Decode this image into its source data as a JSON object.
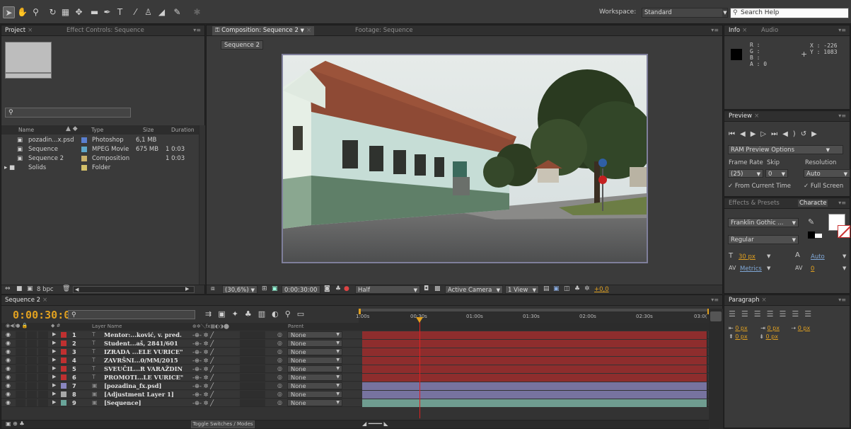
{
  "toolbar": {
    "workspace_label": "Workspace:",
    "workspace_value": "Standard",
    "search_placeholder": "Search Help",
    "tools": [
      "selection-tool-icon",
      "hand-tool-icon",
      "zoom-tool-icon",
      "rotate-tool-icon",
      "camera-tool-icon",
      "pan-behind-tool-icon",
      "mask-tool-icon",
      "pen-tool-icon",
      "type-tool-icon",
      "brush-tool-icon",
      "clone-stamp-icon",
      "eraser-icon",
      "roto-brush-icon",
      "puppet-pin-icon"
    ]
  },
  "project": {
    "tab_project": "Project",
    "tab_effects": "Effect Controls: Sequence",
    "columns": {
      "name": "Name",
      "type": "Type",
      "size": "Size",
      "duration": "Duration"
    },
    "items": [
      {
        "name": "pozadin...x.psd",
        "type": "Photoshop",
        "size": "6,1 MB",
        "duration": "",
        "color": "#5a7fd0",
        "icon": "photoshop-file-icon"
      },
      {
        "name": "Sequence",
        "type": "MPEG Movie",
        "size": "675 MB",
        "duration": "1 0:03",
        "color": "#5fa6c9",
        "icon": "movie-file-icon"
      },
      {
        "name": "Sequence 2",
        "type": "Composition",
        "size": "",
        "duration": "1 0:03",
        "color": "#c9b06a",
        "icon": "composition-icon"
      },
      {
        "name": "Solids",
        "type": "Folder",
        "size": "",
        "duration": "",
        "color": "#d4c06a",
        "icon": "folder-icon"
      }
    ],
    "bpc": "8 bpc"
  },
  "composition": {
    "tab_comp": "Composition: Sequence 2",
    "tab_footage": "Footage: Sequence",
    "breadcrumb": "Sequence 2",
    "zoom": "(30,6%)",
    "timecode": "0:00:30:00",
    "resolution": "Half",
    "camera": "Active Camera",
    "views": "1 View",
    "exposure": "+0,0"
  },
  "info": {
    "tab_info": "Info",
    "tab_audio": "Audio",
    "r": "R :",
    "g": "G :",
    "b": "B :",
    "a": "A : 0",
    "x": "X : -226",
    "y": "Y : 1083"
  },
  "preview": {
    "tab": "Preview",
    "ram_options": "RAM Preview Options",
    "frame_rate_label": "Frame Rate",
    "skip_label": "Skip",
    "resolution_label": "Resolution",
    "frame_rate": "(25)",
    "skip": "0",
    "resolution": "Auto",
    "from_current": "From Current Time",
    "full_screen": "Full Screen"
  },
  "character": {
    "tab_effects": "Effects & Presets",
    "tab_character": "Characte",
    "font": "Franklin Gothic ...",
    "style": "Regular",
    "size": "30 px",
    "leading": "Auto",
    "kerning": "Metrics",
    "tracking": "0"
  },
  "paragraph": {
    "tab": "Paragraph",
    "indent1": "0 px",
    "indent2": "0 px",
    "indent3": "0 px",
    "space1": "0 px",
    "space2": "0 px"
  },
  "timeline": {
    "tab": "Sequence 2",
    "timecode": "0:00:30:00",
    "col_layer_name": "Layer Name",
    "col_parent": "Parent",
    "ruler": [
      "1:00s",
      "00:30s",
      "01:00s",
      "01:30s",
      "02:00s",
      "02:30s",
      "03:0("
    ],
    "toggle_label": "Toggle Switches / Modes",
    "layers": [
      {
        "num": "1",
        "name": "Mentor:...ković, v. pred.",
        "parent": "None",
        "color": "#c03030",
        "bar": "#8e2d2d",
        "text_icon": true
      },
      {
        "num": "2",
        "name": "Student...aš, 2841/601",
        "parent": "None",
        "color": "#c03030",
        "bar": "#8e2d2d",
        "text_icon": true
      },
      {
        "num": "3",
        "name": "IZRADA ...ELE VURICE\"",
        "parent": "None",
        "color": "#c03030",
        "bar": "#8e2d2d",
        "text_icon": true
      },
      {
        "num": "4",
        "name": "ZAVRŠNI...0/MM/2015",
        "parent": "None",
        "color": "#c03030",
        "bar": "#8e2d2d",
        "text_icon": true
      },
      {
        "num": "5",
        "name": "SVEUČIL...R VARAŽDIN",
        "parent": "None",
        "color": "#c03030",
        "bar": "#8e2d2d",
        "text_icon": true
      },
      {
        "num": "6",
        "name": "PROMOTI...LE VURICE\"",
        "parent": "None",
        "color": "#c03030",
        "bar": "#8e2d2d",
        "text_icon": true
      },
      {
        "num": "7",
        "name": "[pozadina_fx.psd]",
        "parent": "None",
        "color": "#8a86c0",
        "bar": "#77739f",
        "text_icon": false
      },
      {
        "num": "8",
        "name": "[Adjustment Layer 1]",
        "parent": "None",
        "color": "#a9a9a9",
        "bar": "#77739f",
        "text_icon": false
      },
      {
        "num": "9",
        "name": "[Sequence]",
        "parent": "None",
        "color": "#6aa59a",
        "bar": "#6f9c90",
        "text_icon": false
      }
    ]
  },
  "colors": {
    "accent": "#e0a020",
    "panel": "#3a3a3a",
    "dark": "#232323"
  }
}
